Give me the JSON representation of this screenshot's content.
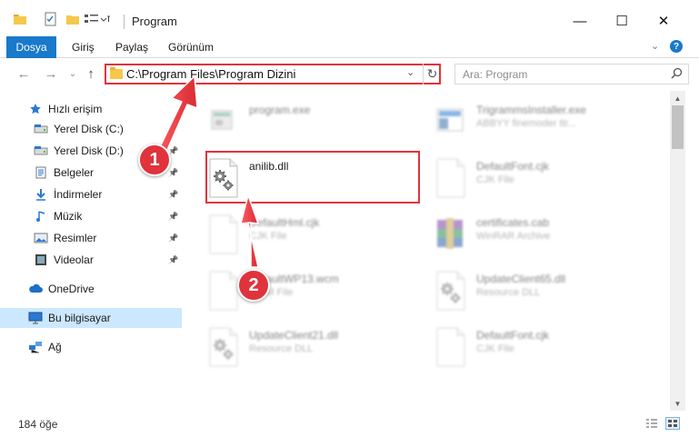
{
  "window": {
    "title": "Program",
    "minimize": "—",
    "maximize": "☐",
    "close": "✕"
  },
  "ribbon": {
    "tabs": [
      "Dosya",
      "Giriş",
      "Paylaş",
      "Görünüm"
    ],
    "expand": "⌄",
    "help": "?"
  },
  "address": {
    "path": "C:\\Program Files\\Program Dizini",
    "dropdown": "⌄",
    "refresh": "↻",
    "search_placeholder": "Ara: Program"
  },
  "nav": {
    "back": "←",
    "forward": "→",
    "recent": "⌄",
    "up": "↑",
    "items": [
      {
        "label": "Hızlı erişim",
        "icon": "star-icon",
        "pinned": false
      },
      {
        "label": "Yerel Disk (C:)",
        "icon": "drive-icon",
        "pinned": true
      },
      {
        "label": "Yerel Disk (D:)",
        "icon": "drive-icon",
        "pinned": true
      },
      {
        "label": "Belgeler",
        "icon": "documents-icon",
        "pinned": true
      },
      {
        "label": "İndirmeler",
        "icon": "download-icon",
        "pinned": true
      },
      {
        "label": "Müzik",
        "icon": "music-icon",
        "pinned": true
      },
      {
        "label": "Resimler",
        "icon": "pictures-icon",
        "pinned": true
      },
      {
        "label": "Videolar",
        "icon": "videos-icon",
        "pinned": true
      },
      {
        "label": "OneDrive",
        "icon": "cloud-icon",
        "pinned": false
      },
      {
        "label": "Bu bilgisayar",
        "icon": "computer-icon",
        "pinned": false
      },
      {
        "label": "Ağ",
        "icon": "network-icon",
        "pinned": false
      }
    ]
  },
  "files": [
    {
      "name": "program.exe",
      "type": "",
      "icon": "exe-icon",
      "blurred": true
    },
    {
      "name": "TrigrammsInstaller.exe",
      "type": "ABBYY finemoder ttr...",
      "icon": "installer-icon",
      "blurred": true
    },
    {
      "name": "anilib.dll",
      "type": "",
      "icon": "dll-gear-icon",
      "blurred": false
    },
    {
      "name": "DefaultFont.cjk",
      "type": "CJK File",
      "icon": "generic-file-icon",
      "blurred": true
    },
    {
      "name": "DefaultHml.cjk",
      "type": "CJK File",
      "icon": "generic-file-icon",
      "blurred": true
    },
    {
      "name": "certificates.cab",
      "type": "WinRAR Archive",
      "icon": "archive-icon",
      "blurred": true
    },
    {
      "name": "DefaultWP13.wcm",
      "type": "WCM File",
      "icon": "generic-file-icon",
      "blurred": true
    },
    {
      "name": "UpdateClient65.dll",
      "type": "Resource DLL",
      "icon": "dll-gear-icon",
      "blurred": true
    },
    {
      "name": "UpdateClient21.dll",
      "type": "Resource DLL",
      "icon": "dll-gear-icon",
      "blurred": true
    },
    {
      "name": "DefaultFont.cjk",
      "type": "CJK File",
      "icon": "generic-file-icon",
      "blurred": true
    }
  ],
  "status": {
    "count": "184 öğe"
  },
  "callouts": [
    "1",
    "2"
  ],
  "colors": {
    "accent": "#1979ca",
    "highlight": "#e0333c",
    "selection": "#cce8ff"
  }
}
